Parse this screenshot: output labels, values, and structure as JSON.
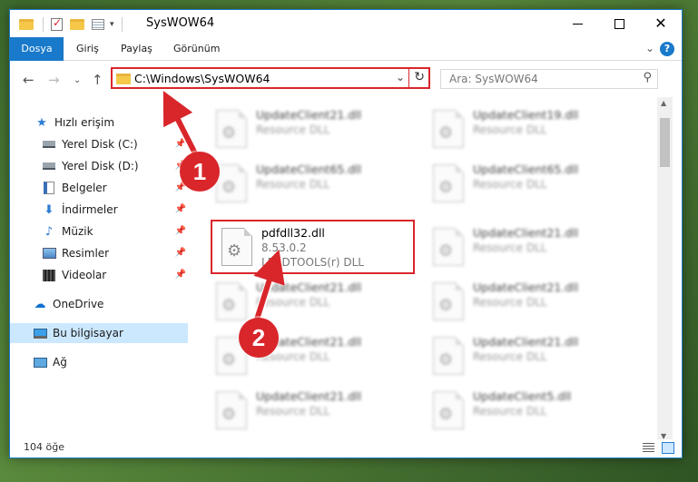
{
  "window": {
    "title": "SysWOW64"
  },
  "ribbon": {
    "tabs": [
      "Dosya",
      "Giriş",
      "Paylaş",
      "Görünüm"
    ],
    "help": "?"
  },
  "address": {
    "path": "C:\\Windows\\SysWOW64",
    "search_placeholder": "Ara: SysWOW64"
  },
  "sidebar": {
    "items": [
      {
        "label": "Hızlı erişim",
        "icon": "star-icon",
        "pinned": false
      },
      {
        "label": "Yerel Disk (C:)",
        "icon": "disk-icon",
        "pinned": true
      },
      {
        "label": "Yerel Disk (D:)",
        "icon": "disk-icon",
        "pinned": true
      },
      {
        "label": "Belgeler",
        "icon": "document-icon",
        "pinned": true
      },
      {
        "label": "İndirmeler",
        "icon": "download-icon",
        "pinned": true
      },
      {
        "label": "Müzik",
        "icon": "music-icon",
        "pinned": true
      },
      {
        "label": "Resimler",
        "icon": "pictures-icon",
        "pinned": true
      },
      {
        "label": "Videolar",
        "icon": "videos-icon",
        "pinned": true
      },
      {
        "label": "OneDrive",
        "icon": "onedrive-icon",
        "pinned": false
      },
      {
        "label": "Bu bilgisayar",
        "icon": "computer-icon",
        "pinned": false,
        "selected": true
      },
      {
        "label": "Ağ",
        "icon": "network-icon",
        "pinned": false
      }
    ]
  },
  "files": {
    "highlighted": {
      "name": "pdfdll32.dll",
      "version": "8.53.0.2",
      "description": "LEADTOOLS(r) DLL"
    },
    "blurred": [
      {
        "name": "UpdateClient21.dll",
        "description": "Resource DLL"
      },
      {
        "name": "UpdateClient19.dll",
        "description": "Resource DLL"
      },
      {
        "name": "UpdateClient65.dll",
        "description": "Resource DLL"
      },
      {
        "name": "UpdateClient65.dll",
        "description": "Resource DLL"
      },
      {
        "name": "UpdateClient21.dll",
        "description": "Resource DLL"
      },
      {
        "name": "UpdateClient21.dll",
        "description": "Resource DLL"
      },
      {
        "name": "UpdateClient21.dll",
        "description": "Resource DLL"
      },
      {
        "name": "UpdateClient21.dll",
        "description": "Resource DLL"
      },
      {
        "name": "UpdateClient21.dll",
        "description": "Resource DLL"
      },
      {
        "name": "UpdateClient21.dll",
        "description": "Resource DLL"
      },
      {
        "name": "UpdateClient5.dll",
        "description": "Resource DLL"
      }
    ]
  },
  "status": {
    "count": "104 öğe"
  },
  "annotations": {
    "step1": "1",
    "step2": "2",
    "color": "#d9262b"
  }
}
